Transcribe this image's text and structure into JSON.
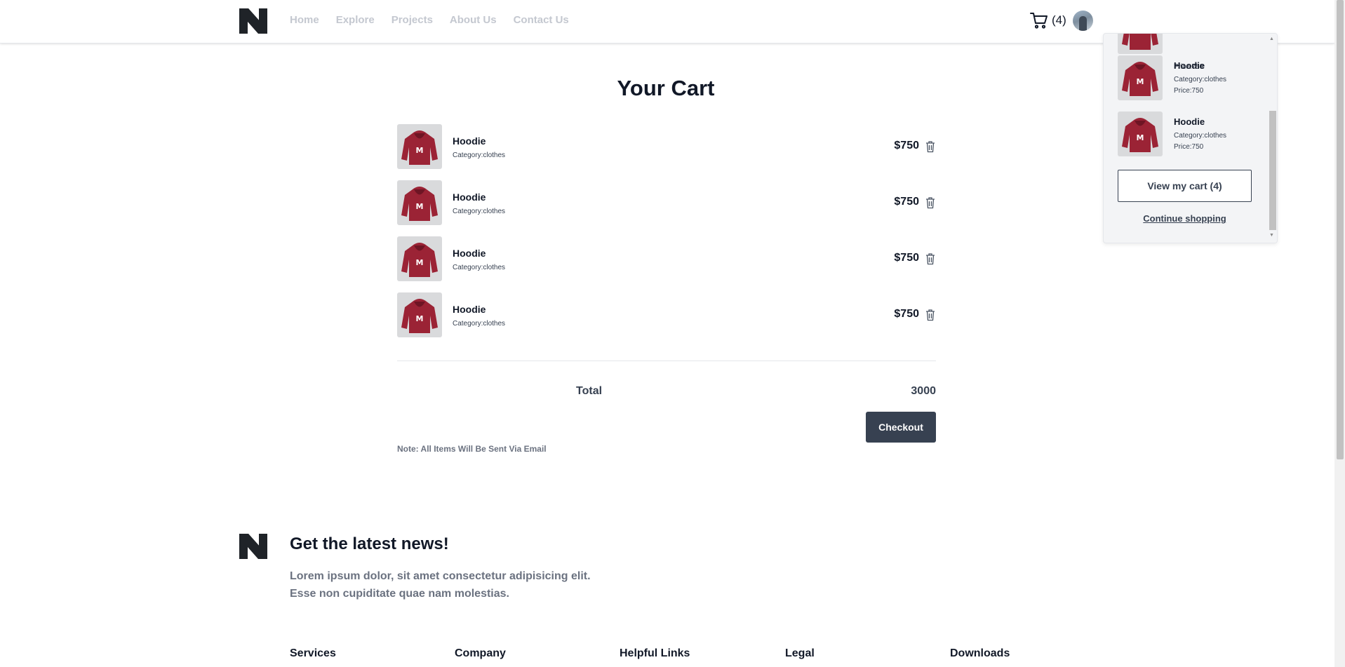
{
  "header": {
    "nav": [
      {
        "label": "Home"
      },
      {
        "label": "Explore"
      },
      {
        "label": "Projects"
      },
      {
        "label": "About Us"
      },
      {
        "label": "Contact Us"
      }
    ],
    "cart_count": "(4)",
    "logo_icon": "n-logo-icon",
    "cart_icon": "shopping-cart-icon"
  },
  "main": {
    "title": "Your Cart",
    "items": [
      {
        "name": "Hoodie",
        "category": "Category:clothes",
        "price": "$750"
      },
      {
        "name": "Hoodie",
        "category": "Category:clothes",
        "price": "$750"
      },
      {
        "name": "Hoodie",
        "category": "Category:clothes",
        "price": "$750"
      },
      {
        "name": "Hoodie",
        "category": "Category:clothes",
        "price": "$750"
      }
    ],
    "total_label": "Total",
    "total_value": "3000",
    "checkout_label": "Checkout",
    "note": "Note: All Items Will Be Sent Via Email",
    "trash_icon": "trash-icon"
  },
  "dropdown": {
    "partial_price": "Price:750",
    "items": [
      {
        "name": "Hoodie",
        "category": "Category:clothes",
        "price": "Price:750"
      },
      {
        "name": "Hoodie",
        "category": "Category:clothes",
        "price": "Price:750"
      }
    ],
    "view_cart_label": "View my cart (4)",
    "continue_label": "Continue shopping"
  },
  "footer": {
    "news_title": "Get the latest news!",
    "news_line1": "Lorem ipsum dolor, sit amet consectetur adipisicing elit.",
    "news_line2": "Esse non cupiditate quae nam molestias.",
    "columns": [
      "Services",
      "Company",
      "Helpful Links",
      "Legal",
      "Downloads"
    ]
  },
  "colors": {
    "primary_dark": "#374151",
    "nav_text": "#c4c8d0",
    "hoodie": "#9b2335"
  }
}
